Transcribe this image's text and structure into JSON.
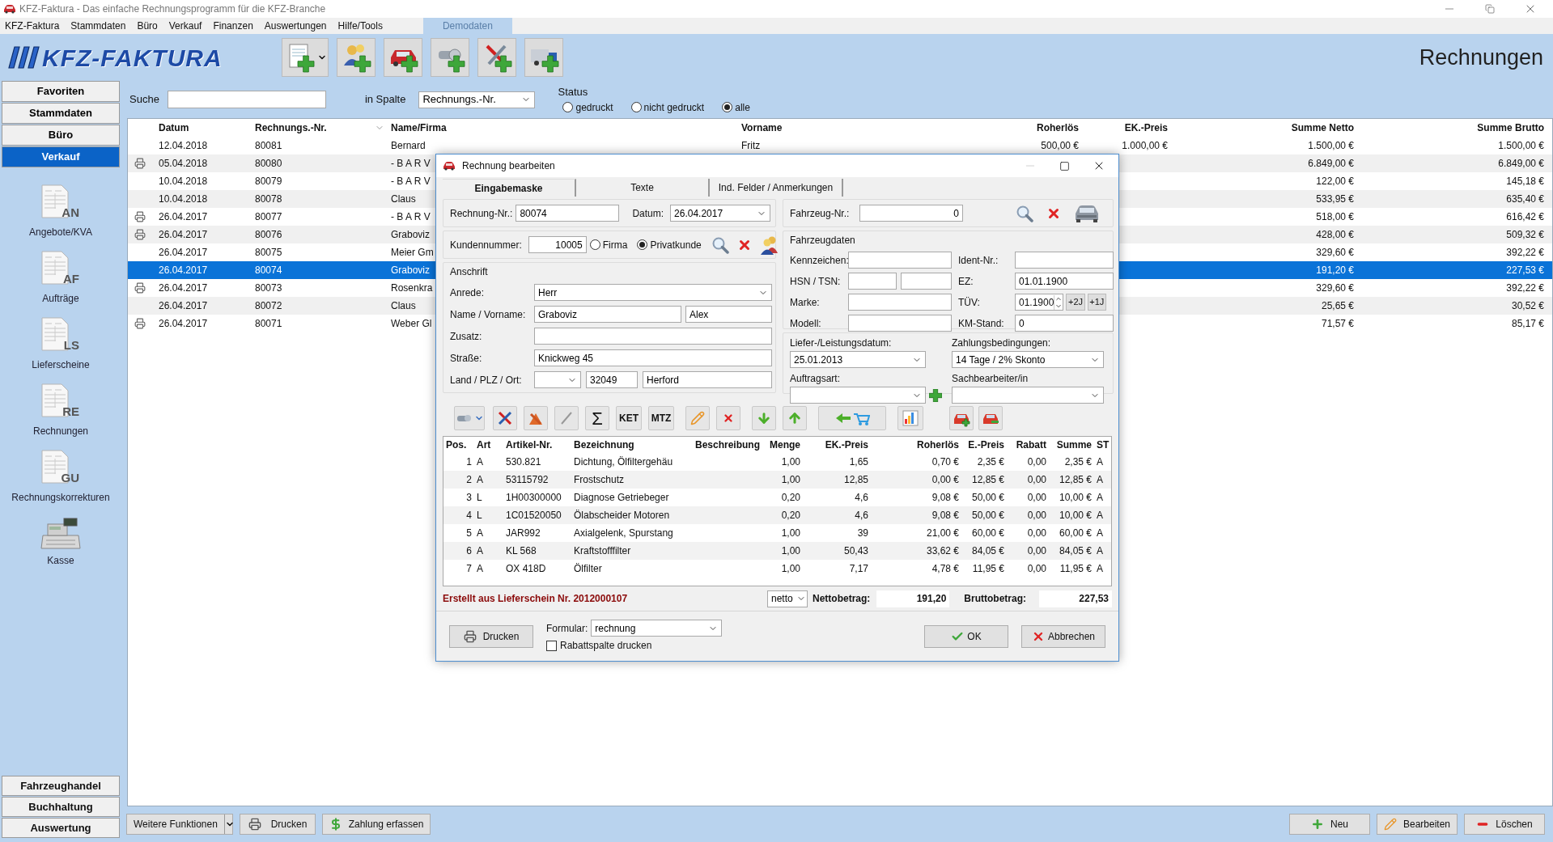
{
  "window": {
    "title": "KFZ-Faktura - Das einfache Rechnungsprogramm für die KFZ-Branche"
  },
  "menu": [
    "KFZ-Faktura",
    "Stammdaten",
    "Büro",
    "Verkauf",
    "Finanzen",
    "Auswertungen",
    "Hilfe/Tools"
  ],
  "demo_badge": "Demodaten",
  "header": {
    "logo": "KFZ-FAKTURA",
    "title": "Rechnungen"
  },
  "sidebar": {
    "sections": [
      {
        "label": "Favoriten",
        "selected": false
      },
      {
        "label": "Stammdaten",
        "selected": false
      },
      {
        "label": "Büro",
        "selected": false
      },
      {
        "label": "Verkauf",
        "selected": true
      }
    ],
    "items": [
      {
        "kind": "document",
        "code": "AN",
        "label": "Angebote/KVA"
      },
      {
        "kind": "document",
        "code": "AF",
        "label": "Aufträge"
      },
      {
        "kind": "document",
        "code": "LS",
        "label": "Lieferscheine"
      },
      {
        "kind": "document",
        "code": "RE",
        "label": "Rechnungen"
      },
      {
        "kind": "document",
        "code": "GU",
        "label": "Rechnungskorrekturen"
      },
      {
        "kind": "register",
        "label": "Kasse"
      }
    ],
    "bottom_sections": [
      "Fahrzeughandel",
      "Buchhaltung",
      "Auswertung"
    ]
  },
  "filter": {
    "search_label": "Suche",
    "column_label": "in Spalte",
    "column_value": "Rechnungs.-Nr.",
    "status_label": "Status",
    "status_options": [
      {
        "label": "gedruckt",
        "selected": false
      },
      {
        "label": "nicht gedruckt",
        "selected": false
      },
      {
        "label": "alle",
        "selected": true
      }
    ]
  },
  "table": {
    "columns": [
      {
        "label": "Datum",
        "sorted": false
      },
      {
        "label": "Rechnungs.-Nr.",
        "sorted": true
      },
      {
        "label": "Name/Firma",
        "sorted": false
      },
      {
        "label": "Vorname",
        "sorted": false
      },
      {
        "label": "Roherlös",
        "sorted": false
      },
      {
        "label": "EK.-Preis",
        "sorted": false
      },
      {
        "label": "Summe Netto",
        "sorted": false
      },
      {
        "label": "Summe Brutto",
        "sorted": false
      }
    ],
    "rows": [
      {
        "printed": false,
        "selected": false,
        "date": "12.04.2018",
        "nr": "80081",
        "name": "Bernard",
        "first_name": "Fritz",
        "margin": "500,00 €",
        "cost": "1.000,00 €",
        "net": "1.500,00 €",
        "gross": "1.500,00 €"
      },
      {
        "printed": true,
        "selected": false,
        "date": "05.04.2018",
        "nr": "80080",
        "name": "- B A R V",
        "net": "6.849,00 €",
        "gross": "6.849,00 €"
      },
      {
        "printed": false,
        "selected": false,
        "date": "10.04.2018",
        "nr": "80079",
        "name": "- B A R V",
        "net": "122,00 €",
        "gross": "145,18 €"
      },
      {
        "printed": false,
        "selected": false,
        "date": "10.04.2018",
        "nr": "80078",
        "name": "Claus",
        "net": "533,95 €",
        "gross": "635,40 €"
      },
      {
        "printed": true,
        "selected": false,
        "date": "26.04.2017",
        "nr": "80077",
        "name": "- B A R V",
        "net": "518,00 €",
        "gross": "616,42 €"
      },
      {
        "printed": true,
        "selected": false,
        "date": "26.04.2017",
        "nr": "80076",
        "name": "Graboviz",
        "net": "428,00 €",
        "gross": "509,32 €"
      },
      {
        "printed": false,
        "selected": false,
        "date": "26.04.2017",
        "nr": "80075",
        "name": "Meier Gm",
        "net": "329,60 €",
        "gross": "392,22 €"
      },
      {
        "printed": false,
        "selected": true,
        "date": "26.04.2017",
        "nr": "80074",
        "name": "Graboviz",
        "net": "191,20 €",
        "gross": "227,53 €"
      },
      {
        "printed": true,
        "selected": false,
        "date": "26.04.2017",
        "nr": "80073",
        "name": "Rosenkra",
        "net": "329,60 €",
        "gross": "392,22 €"
      },
      {
        "printed": false,
        "selected": false,
        "date": "26.04.2017",
        "nr": "80072",
        "name": "Claus",
        "net": "25,65 €",
        "gross": "30,52 €"
      },
      {
        "printed": true,
        "selected": false,
        "date": "26.04.2017",
        "nr": "80071",
        "name": "Weber Gl",
        "net": "71,57 €",
        "gross": "85,17 €"
      }
    ]
  },
  "bottom_bar": {
    "left": [
      "Weitere Funktionen",
      "Drucken",
      "Zahlung erfassen"
    ],
    "right": [
      "Neu",
      "Bearbeiten",
      "Löschen"
    ]
  },
  "dialog": {
    "title": "Rechnung bearbeiten",
    "tabs": [
      {
        "label": "Eingabemaske",
        "selected": true
      },
      {
        "label": "Texte",
        "selected": false
      },
      {
        "label": "Ind. Felder / Anmerkungen",
        "selected": false
      }
    ],
    "invoice": {
      "nr_label": "Rechnung-Nr.:",
      "nr": "80074",
      "date_label": "Datum:",
      "date": "26.04.2017"
    },
    "customer": {
      "label": "Kundennummer:",
      "value": "10005",
      "types": [
        {
          "label": "Firma",
          "selected": false
        },
        {
          "label": "Privatkunde",
          "selected": true
        }
      ]
    },
    "address": {
      "title": "Anschrift",
      "salutation_label": "Anrede:",
      "salutation": "Herr",
      "name_label": "Name / Vorname:",
      "last_name": "Graboviz",
      "first_name": "Alex",
      "extra_label": "Zusatz:",
      "street_label": "Straße:",
      "street": "Knickweg 45",
      "place_label": "Land / PLZ / Ort:",
      "zip": "32049",
      "city": "Herford"
    },
    "vehicle": {
      "nr_label": "Fahrzeug-Nr.:",
      "nr": "0",
      "title": "Fahrzeugdaten",
      "plate_label": "Kennzeichen:",
      "ident_label": "Ident-Nr.:",
      "hsn_label": "HSN / TSN:",
      "ez_label": "EZ:",
      "ez": "01.01.1900",
      "brand_label": "Marke:",
      "tuev_label": "TÜV:",
      "tuev": "01.1900",
      "tuev_buttons": [
        "+2J",
        "+1J"
      ],
      "model_label": "Modell:",
      "km_label": "KM-Stand:",
      "km": "0"
    },
    "terms": {
      "delivery_label": "Liefer-/Leistungsdatum:",
      "delivery": "25.01.2013",
      "payment_label": "Zahlungsbedingungen:",
      "payment": "14 Tage / 2% Skonto",
      "order_type_label": "Auftragsart:",
      "clerk_label": "Sachbearbeiter/in"
    },
    "tool_texts": [
      "Σ",
      "KET",
      "MTZ"
    ],
    "positions": {
      "columns": [
        "Pos.",
        "Art",
        "Artikel-Nr.",
        "Bezeichnung",
        "Beschreibung",
        "Menge",
        "EK.-Preis",
        "Roherlös",
        "E.-Preis",
        "Rabatt",
        "Summe",
        "ST"
      ],
      "rows": [
        [
          "1",
          "A",
          "530.821",
          "Dichtung, Ölfiltergehäu",
          "",
          "1,00",
          "1,65",
          "0,70 €",
          "2,35 €",
          "0,00",
          "2,35 €",
          "A"
        ],
        [
          "2",
          "A",
          "53115792",
          "Frostschutz",
          "",
          "1,00",
          "12,85",
          "0,00 €",
          "12,85 €",
          "0,00",
          "12,85 €",
          "A"
        ],
        [
          "3",
          "L",
          "1H00300000",
          "Diagnose Getriebeger",
          "",
          "0,20",
          "4,6",
          "9,08 €",
          "50,00 €",
          "0,00",
          "10,00 €",
          "A"
        ],
        [
          "4",
          "L",
          "1C01520050",
          "Ölabscheider Motoren",
          "",
          "0,20",
          "4,6",
          "9,08 €",
          "50,00 €",
          "0,00",
          "10,00 €",
          "A"
        ],
        [
          "5",
          "A",
          "JAR992",
          "Axialgelenk, Spurstang",
          "",
          "1,00",
          "39",
          "21,00 €",
          "60,00 €",
          "0,00",
          "60,00 €",
          "A"
        ],
        [
          "6",
          "A",
          "KL 568",
          "Kraftstofffilter",
          "",
          "1,00",
          "50,43",
          "33,62 €",
          "84,05 €",
          "0,00",
          "84,05 €",
          "A"
        ],
        [
          "7",
          "A",
          "OX 418D",
          "Ölfilter",
          "",
          "1,00",
          "7,17",
          "4,78 €",
          "11,95 €",
          "0,00",
          "11,95 €",
          "A"
        ]
      ]
    },
    "source_note": "Erstellt aus Lieferschein Nr. 2012000107",
    "mode": "netto",
    "net_label": "Nettobetrag:",
    "net": "191,20",
    "gross_label": "Bruttobetrag:",
    "gross": "227,53",
    "print_button": "Drucken",
    "form_label": "Formular:",
    "form": "rechnung",
    "discount_print": {
      "label": "Rabattspalte drucken",
      "checked": false
    },
    "ok": "OK",
    "cancel": "Abbrechen"
  }
}
